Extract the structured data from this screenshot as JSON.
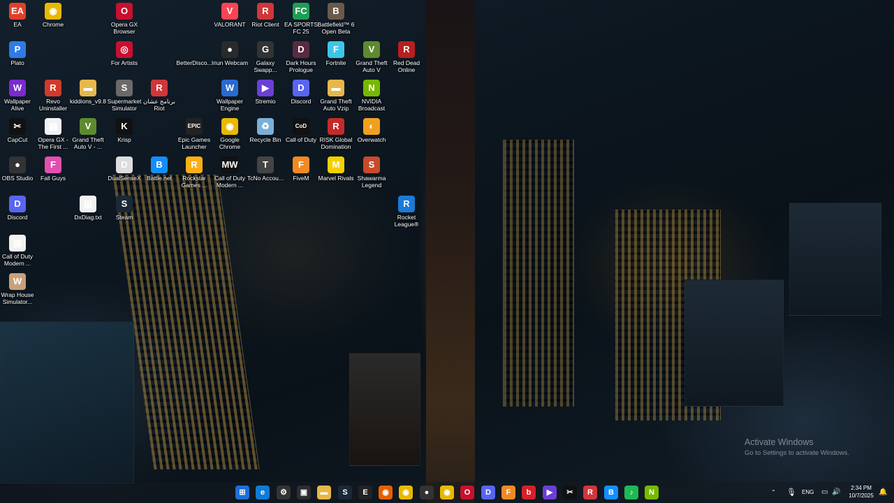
{
  "desktop_icons": [
    {
      "label": "EA",
      "glyph": "EA",
      "color": "#e0402a"
    },
    {
      "label": "Chrome",
      "glyph": "◉",
      "color": "#e8b900"
    },
    {
      "label": "Opera GX Browser",
      "glyph": "O",
      "color": "#c8102e"
    },
    {
      "label": "VALORANT",
      "glyph": "V",
      "color": "#fa4454"
    },
    {
      "label": "Riot Client",
      "glyph": "R",
      "color": "#d13639"
    },
    {
      "label": "EA SPORTS FC 25",
      "glyph": "FC",
      "color": "#1f9d55"
    },
    {
      "label": "Battlefield™ 6 Open Beta",
      "glyph": "B",
      "color": "#6b5a4a"
    },
    {
      "label": "Plato",
      "glyph": "P",
      "color": "#2f7be5"
    },
    {
      "label": "For Artists",
      "glyph": "◎",
      "color": "#c8102e"
    },
    {
      "label": "BetterDisco...",
      "glyph": "",
      "color": "transparent"
    },
    {
      "label": "Iriun Webcam",
      "glyph": "●",
      "color": "#2a2a2a"
    },
    {
      "label": "Galaxy Swapp...",
      "glyph": "G",
      "color": "#333333"
    },
    {
      "label": "Dark Hours Prologue",
      "glyph": "D",
      "color": "#5a2a40"
    },
    {
      "label": "Fortnite",
      "glyph": "F",
      "color": "#3ec6e8"
    },
    {
      "label": "Grand Theft Auto V",
      "glyph": "V",
      "color": "#5d8a2e"
    },
    {
      "label": "Red Dead Online",
      "glyph": "R",
      "color": "#b81f1f"
    },
    {
      "label": "Wallpaper Alive",
      "glyph": "W",
      "color": "#7a2ad1"
    },
    {
      "label": "Revo Uninstaller",
      "glyph": "R",
      "color": "#d13a2a"
    },
    {
      "label": "kiddions_v9.8",
      "glyph": "▬",
      "color": "#e6b84a"
    },
    {
      "label": "Supermarket Simulator",
      "glyph": "S",
      "color": "#6a6a6a"
    },
    {
      "label": "برنامج عشان Riot",
      "glyph": "R",
      "color": "#d13639"
    },
    {
      "label": "Wallpaper Engine",
      "glyph": "W",
      "color": "#2a6ad1"
    },
    {
      "label": "Stremio",
      "glyph": "▶",
      "color": "#6b3fd6"
    },
    {
      "label": "Discord",
      "glyph": "D",
      "color": "#5865f2"
    },
    {
      "label": "Grand Theft Auto Vzip",
      "glyph": "▬",
      "color": "#e6b84a"
    },
    {
      "label": "NVIDIA Broadcast",
      "glyph": "N",
      "color": "#76b900"
    },
    {
      "label": "CapCut",
      "glyph": "✂",
      "color": "#111111"
    },
    {
      "label": "Opera GX - The First ...",
      "glyph": "▤",
      "color": "#f2f2f2"
    },
    {
      "label": "Grand Theft Auto V - ...",
      "glyph": "V",
      "color": "#5d8a2e"
    },
    {
      "label": "Krisp",
      "glyph": "K",
      "color": "#111111"
    },
    {
      "label": "Epic Games Launcher",
      "glyph": "EPIC",
      "color": "#222222"
    },
    {
      "label": "Google Chrome",
      "glyph": "◉",
      "color": "#e8b900"
    },
    {
      "label": "Recycle Bin",
      "glyph": "♻",
      "color": "#7ab0d8"
    },
    {
      "label": "Call of Duty",
      "glyph": "CoD",
      "color": "#111111"
    },
    {
      "label": "RISK Global Domination",
      "glyph": "R",
      "color": "#c42a2a"
    },
    {
      "label": "Overwatch",
      "glyph": "◐",
      "color": "#f0a020"
    },
    {
      "label": "OBS Studio",
      "glyph": "●",
      "color": "#333333"
    },
    {
      "label": "Fall Guys",
      "glyph": "F",
      "color": "#e34fb0"
    },
    {
      "label": "DualSenseX",
      "glyph": "D",
      "color": "#dddddd"
    },
    {
      "label": "Battle.net",
      "glyph": "B",
      "color": "#148eff"
    },
    {
      "label": "Rockstar Games ...",
      "glyph": "R",
      "color": "#fcaf17"
    },
    {
      "label": "Call of Duty Modern ...",
      "glyph": "MW",
      "color": "#111111"
    },
    {
      "label": "TcNo Accou...",
      "glyph": "T",
      "color": "#444444"
    },
    {
      "label": "FiveM",
      "glyph": "F",
      "color": "#f08a24"
    },
    {
      "label": "Marvel Rivals",
      "glyph": "M",
      "color": "#f5d000"
    },
    {
      "label": "Shawarma Legend",
      "glyph": "S",
      "color": "#c84a2a"
    },
    {
      "label": "Discord",
      "glyph": "D",
      "color": "#5865f2"
    },
    {
      "label": "DxDiag.txt",
      "glyph": "▤",
      "color": "#f2f2f2"
    },
    {
      "label": "Steam",
      "glyph": "S",
      "color": "#1b2838"
    },
    {
      "label": "Rocket League®",
      "glyph": "R",
      "color": "#1a7ad6"
    },
    {
      "label": "Call of Duty Modern ...",
      "glyph": "▤",
      "color": "#f2f2f2"
    },
    {
      "label": "Wrap House Simulator...",
      "glyph": "W",
      "color": "#c8a07a"
    }
  ],
  "watermark": {
    "line1": "Activate Windows",
    "line2": "Go to Settings to activate Windows."
  },
  "taskbar": {
    "items": [
      {
        "name": "start-button",
        "glyph": "⊞",
        "color": "#1e6fd9"
      },
      {
        "name": "edge-button",
        "glyph": "e",
        "color": "#0f7bd8"
      },
      {
        "name": "settings-button",
        "glyph": "⚙",
        "color": "#333333"
      },
      {
        "name": "store-button",
        "glyph": "▣",
        "color": "#2d2d2d"
      },
      {
        "name": "file-explorer-button",
        "glyph": "▬",
        "color": "#e6b84a"
      },
      {
        "name": "steam-button",
        "glyph": "S",
        "color": "#1b2838"
      },
      {
        "name": "epic-button",
        "glyph": "E",
        "color": "#222222"
      },
      {
        "name": "firefox-button",
        "glyph": "◉",
        "color": "#e66000"
      },
      {
        "name": "chrome-button",
        "glyph": "◉",
        "color": "#e8b900"
      },
      {
        "name": "github-button",
        "glyph": "●",
        "color": "#333333"
      },
      {
        "name": "chrome-2-button",
        "glyph": "◉",
        "color": "#e8b900"
      },
      {
        "name": "opera-button",
        "glyph": "O",
        "color": "#c8102e"
      },
      {
        "name": "discord-button",
        "glyph": "D",
        "color": "#5865f2"
      },
      {
        "name": "fivem-button",
        "glyph": "F",
        "color": "#f08a24"
      },
      {
        "name": "brave-button",
        "glyph": "b",
        "color": "#d6202a"
      },
      {
        "name": "app-button",
        "glyph": "▶",
        "color": "#6b3fd6"
      },
      {
        "name": "capcut-button",
        "glyph": "✂",
        "color": "#111111"
      },
      {
        "name": "riot-button",
        "glyph": "R",
        "color": "#d13639"
      },
      {
        "name": "battlenet-button",
        "glyph": "B",
        "color": "#148eff"
      },
      {
        "name": "spotify-button",
        "glyph": "♪",
        "color": "#1db954"
      },
      {
        "name": "nvidia-button",
        "glyph": "N",
        "color": "#76b900"
      }
    ]
  },
  "tray": {
    "language": "ENG",
    "time": "2:34 PM",
    "date": "10/7/2025"
  }
}
